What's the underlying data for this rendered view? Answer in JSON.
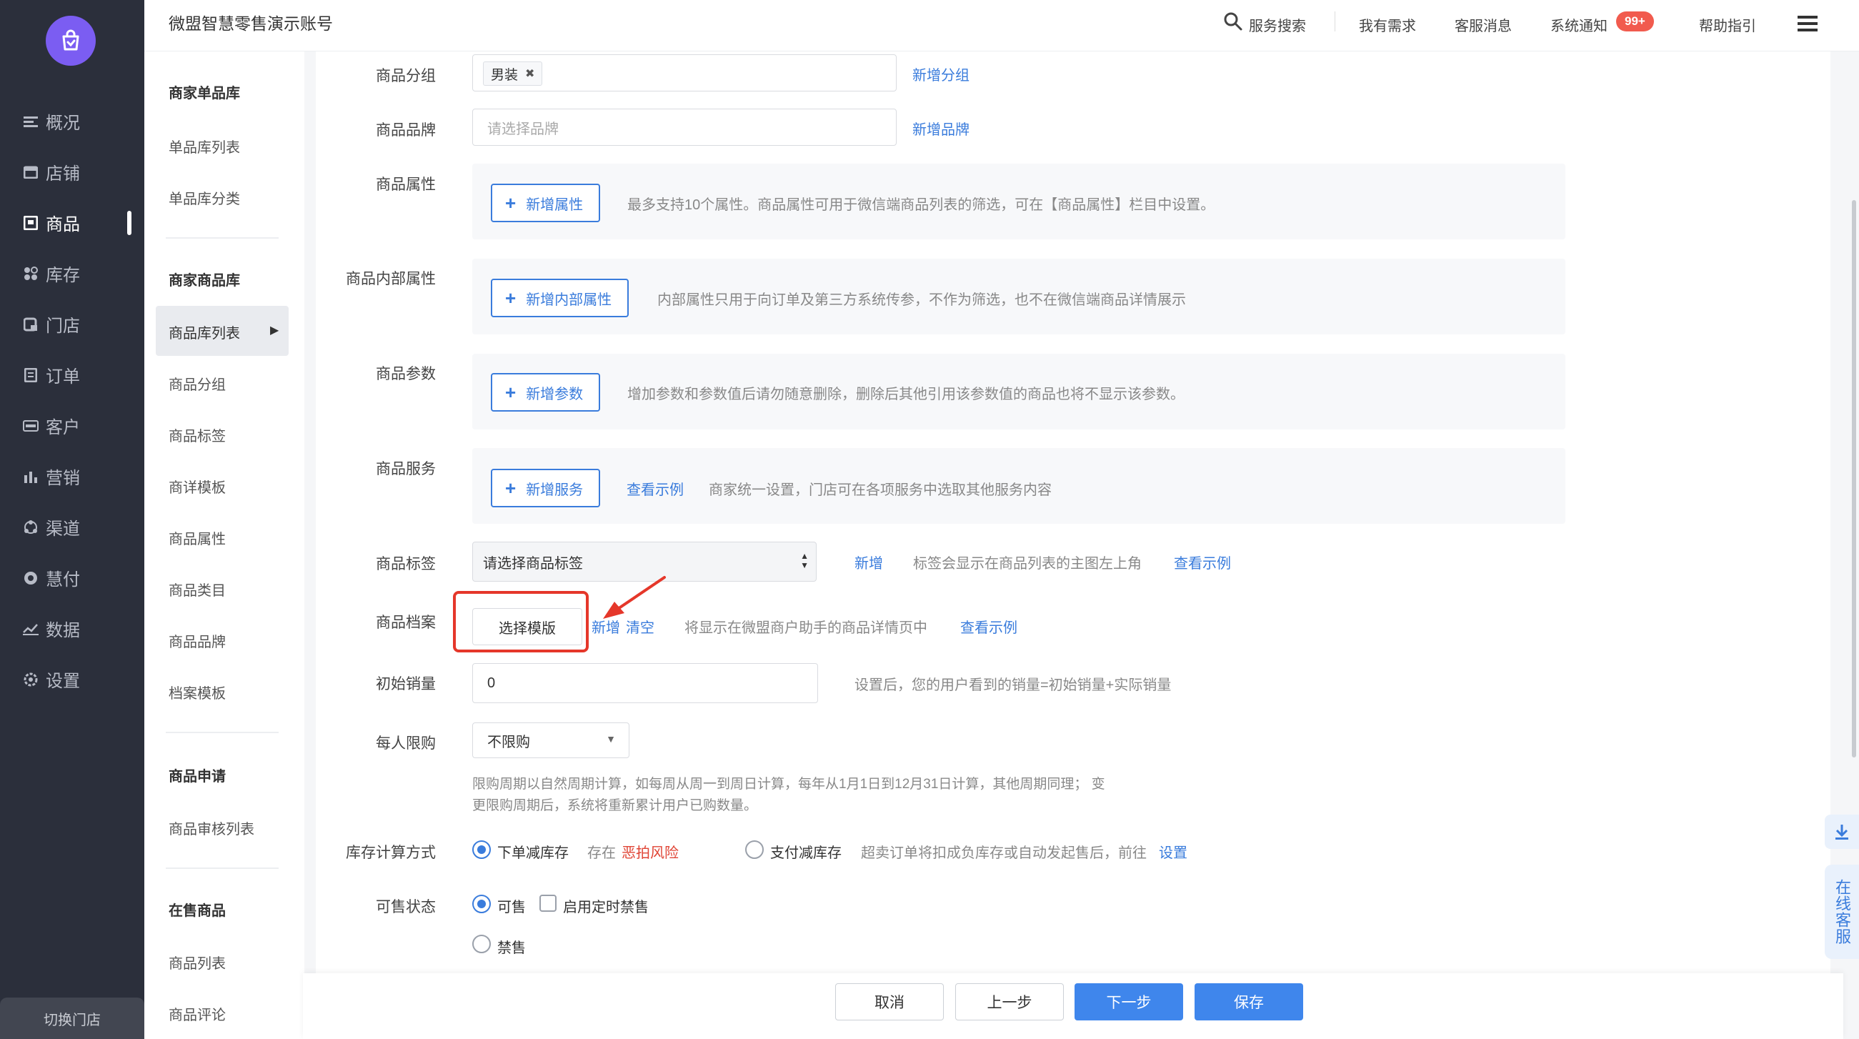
{
  "header": {
    "account_name": "微盟智慧零售演示账号",
    "service_search": "服务搜索",
    "my_needs": "我有需求",
    "cs_messages": "客服消息",
    "sys_notice": "系统通知",
    "notice_badge": "99+",
    "help": "帮助指引"
  },
  "leftnav": {
    "items": [
      {
        "label": "概况"
      },
      {
        "label": "店铺"
      },
      {
        "label": "商品"
      },
      {
        "label": "库存"
      },
      {
        "label": "门店"
      },
      {
        "label": "订单"
      },
      {
        "label": "客户"
      },
      {
        "label": "营销"
      },
      {
        "label": "渠道"
      },
      {
        "label": "慧付"
      },
      {
        "label": "数据"
      },
      {
        "label": "设置"
      }
    ],
    "switch_store": "切换门店"
  },
  "subnav": {
    "g1_title": "商家单品库",
    "g1_items": [
      "单品库列表",
      "单品库分类"
    ],
    "g2_title": "商家商品库",
    "g2_items": [
      "商品库列表",
      "商品分组",
      "商品标签",
      "商详模板",
      "商品属性",
      "商品类目",
      "商品品牌",
      "档案模板"
    ],
    "g3_title": "商品申请",
    "g3_items": [
      "商品审核列表"
    ],
    "g4_title": "在售商品",
    "g4_items": [
      "商品列表",
      "商品评论"
    ]
  },
  "form": {
    "group": {
      "label": "商品分组",
      "tag": "男装",
      "add_link": "新增分组"
    },
    "brand": {
      "label": "商品品牌",
      "placeholder": "请选择品牌",
      "add_link": "新增品牌"
    },
    "attr": {
      "label": "商品属性",
      "button": "新增属性",
      "hint": "最多支持10个属性。商品属性可用于微信端商品列表的筛选，可在【商品属性】栏目中设置。"
    },
    "inner_attr": {
      "label": "商品内部属性",
      "button": "新增内部属性",
      "hint": "内部属性只用于向订单及第三方系统传参，不作为筛选，也不在微信端商品详情展示"
    },
    "param": {
      "label": "商品参数",
      "button": "新增参数",
      "hint": "增加参数和参数值后请勿随意删除，删除后其他引用该参数值的商品也将不显示该参数。"
    },
    "service": {
      "label": "商品服务",
      "button": "新增服务",
      "example": "查看示例",
      "hint": "商家统一设置，门店可在各项服务中选取其他服务内容"
    },
    "tag": {
      "label": "商品标签",
      "select": "请选择商品标签",
      "add": "新增",
      "hint": "标签会显示在商品列表的主图左上角",
      "example": "查看示例"
    },
    "archive": {
      "label": "商品档案",
      "button": "选择模版",
      "add": "新增",
      "clear": "清空",
      "hint": "将显示在微盟商户助手的商品详情页中",
      "example": "查看示例"
    },
    "initial_sales": {
      "label": "初始销量",
      "value": "0",
      "hint": "设置后，您的用户看到的销量=初始销量+实际销量"
    },
    "limit": {
      "label": "每人限购",
      "value": "不限购",
      "hint_line1": "限购周期以自然周期计算，如每周从周一到周日计算，每年从1月1日到12月31日计算，其他周期同理； 变",
      "hint_line2": "更限购周期后，系统将重新累计用户已购数量。"
    },
    "stock_calc": {
      "label": "库存计算方式",
      "opt1": "下单减库存",
      "risk_prefix": "存在",
      "risk": "恶拍风险",
      "opt2": "支付减库存",
      "hint": "超卖订单将扣成负库存或自动发起售后，前往",
      "setting_link": "设置"
    },
    "sale_status": {
      "label": "可售状态",
      "opt_on": "可售",
      "timed": "启用定时禁售",
      "opt_off": "禁售"
    }
  },
  "footer": {
    "cancel": "取消",
    "prev": "上一步",
    "next": "下一步",
    "save": "保存"
  },
  "float": {
    "online_cs": "在线客服"
  }
}
